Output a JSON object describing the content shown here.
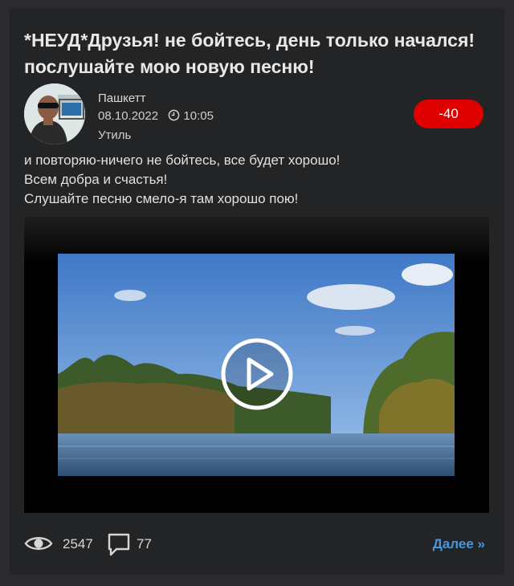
{
  "post": {
    "title": "*НЕУД*Друзья! не бойтесь, день только начался! послушайте мою новую песню!",
    "author": "Пашкетт",
    "date": "08.10.2022",
    "time": "10:05",
    "category": "Утиль",
    "rating": "-40",
    "body_lines": [
      "и повторяю-ничего не бойтесь, все будет хорошо!",
      "Всем добра и счастья!",
      "Слушайте песню смело-я там хорошо пою!"
    ],
    "views": "2547",
    "comments": "77",
    "more_label": "Далее »"
  },
  "icons": {
    "clock": "clock-icon",
    "eye": "eye-icon",
    "comment": "comment-icon",
    "play": "play-icon"
  },
  "colors": {
    "rating_bg": "#e00000",
    "link": "#4a95dc",
    "card_bg": "#232426"
  }
}
